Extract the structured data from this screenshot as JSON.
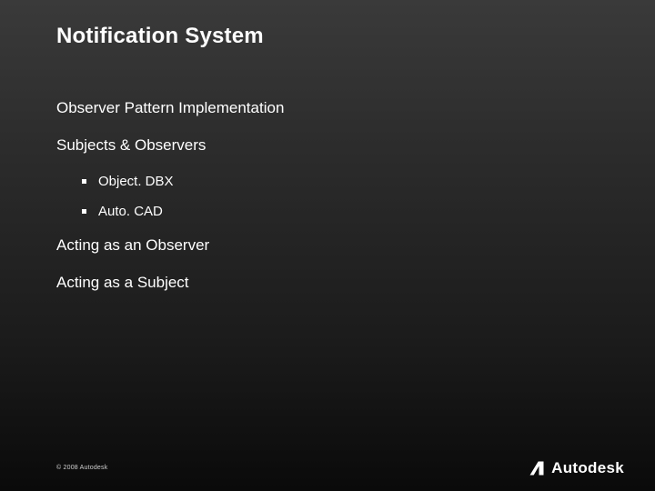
{
  "title": "Notification System",
  "lines": {
    "l1": "Observer Pattern Implementation",
    "l2": "Subjects & Observers",
    "l3": "Acting as an Observer",
    "l4": "Acting as a Subject"
  },
  "sub_items": {
    "s1": "Object. DBX",
    "s2": "Auto. CAD"
  },
  "footer": "© 2008 Autodesk",
  "brand": "Autodesk"
}
